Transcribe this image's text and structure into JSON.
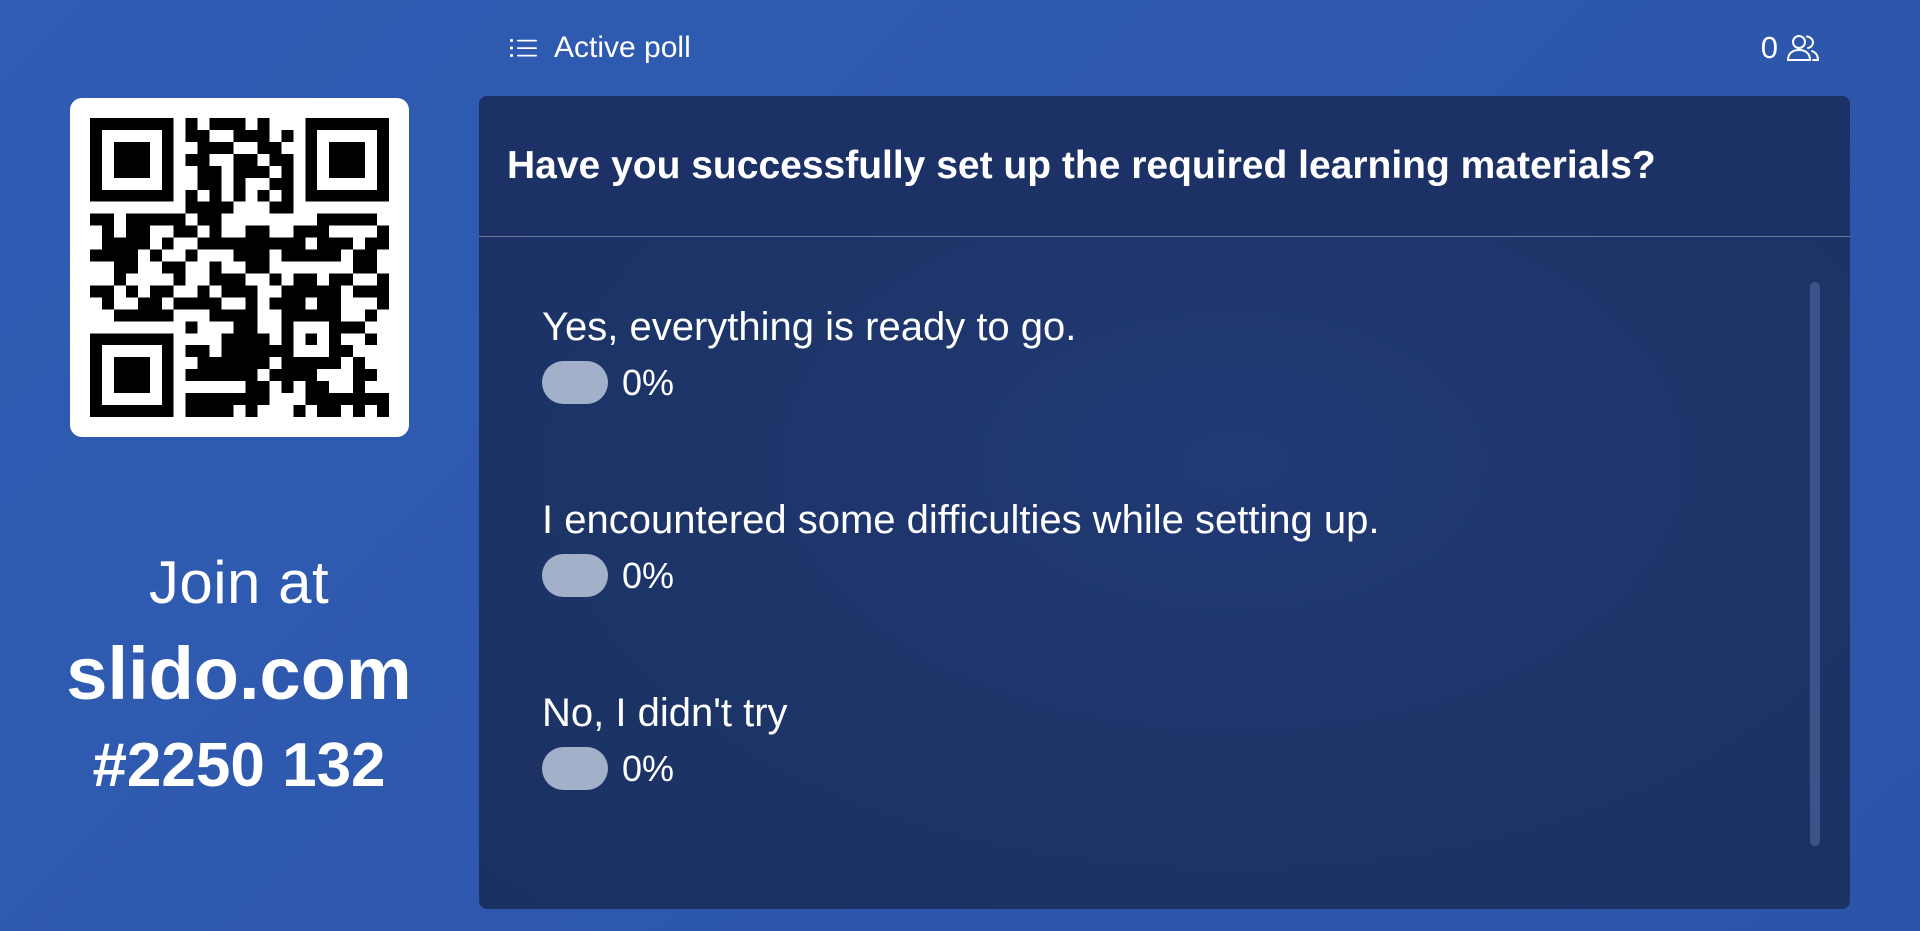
{
  "join": {
    "line": "Join at",
    "site": "slido.com",
    "code": "#2250 132"
  },
  "header": {
    "icon": "list-icon",
    "title": "Active poll",
    "participant_count": "0",
    "participant_icon": "users-icon"
  },
  "poll": {
    "question": "Have you successfully set up the required learning materials?",
    "options": [
      {
        "label": "Yes, everything is ready to go.",
        "percent_label": "0%",
        "percent": 0
      },
      {
        "label": "I encountered some difficulties while setting up.",
        "percent_label": "0%",
        "percent": 0
      },
      {
        "label": "No, I didn't try",
        "percent_label": "0%",
        "percent": 0
      }
    ]
  },
  "colors": {
    "background": "#2d5aae",
    "card": "#1d3468",
    "bar_pill": "#a3b0c9",
    "text": "#ffffff"
  }
}
